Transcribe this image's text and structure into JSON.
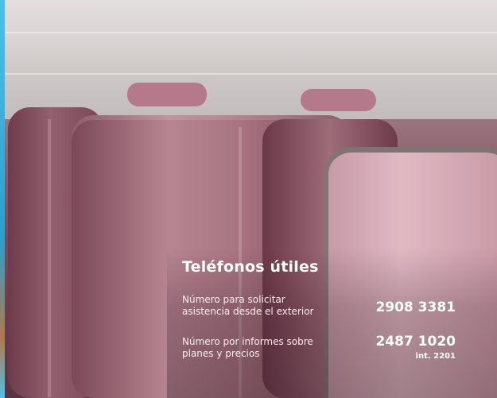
{
  "card": {
    "title": "Teléfonos útiles",
    "entries": [
      {
        "label_line1": "Número para solicitar",
        "label_line2": "asistencia desde el exterior",
        "number": "2908 3381",
        "extension": ""
      },
      {
        "label_line1": "Número por informes sobre",
        "label_line2": "planes y precios",
        "number": "2487 1020",
        "extension": "int. 2201"
      }
    ]
  },
  "background": {
    "subject": "pink-suitcases-photo",
    "accent_color": "#2a9fd0"
  }
}
